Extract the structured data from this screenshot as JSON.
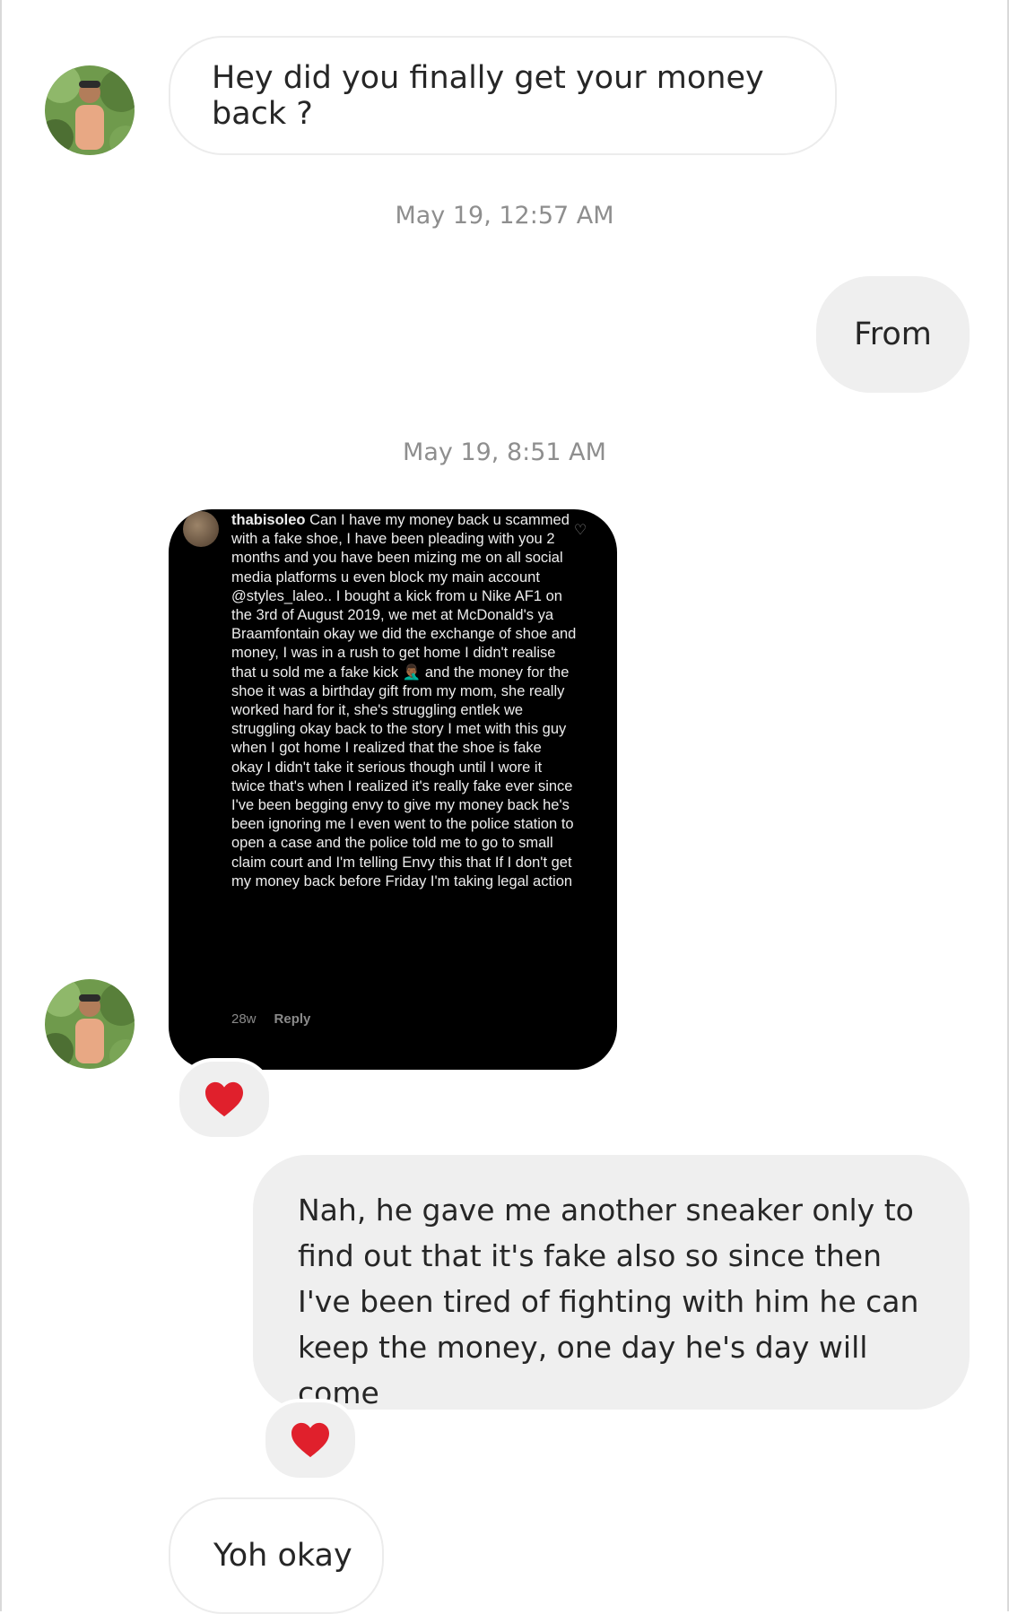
{
  "thread": {
    "msg1": {
      "text": "Hey did you finally get your money back ?"
    },
    "ts1": "May 19, 12:57 AM",
    "msg2": {
      "text": "From"
    },
    "ts2": "May 19, 8:51 AM",
    "shared_comment": {
      "username": "thabisoleo",
      "text": "Can I have my money back u scammed with a fake shoe, I have been pleading with you 2 months and you have been mizing me on all social media platforms u even block my main account @styles_laleo.. I bought a kick from u Nike AF1 on the 3rd of August 2019, we met at McDonald's ya Braamfontain okay we did the exchange of shoe and money, I was in a rush to get home I didn't realise that u sold me a fake kick 🤦🏾‍♂️ and the money for the shoe it was a birthday gift from my mom, she really worked hard for it, she's struggling entlek we struggling okay back to the story I met with this guy when I got home I realized that the shoe is fake okay I didn't take it serious though until I wore it twice that's when I realized it's really fake ever since I've been begging envy to give my money back he's been ignoring me I even went to the police station to open a case and the police told me to go to small claim court and I'm telling Envy this that If I don't get my money back before Friday I'm taking legal action",
      "age": "28w",
      "reply_label": "Reply"
    },
    "reaction1": "heart",
    "msg3": {
      "text": "Nah, he gave me another sneaker only to find out that it's fake also so since then I've been tired of fighting with him he can keep the money, one day he's day will come"
    },
    "reaction2": "heart",
    "msg4": {
      "text": "Yoh okay"
    }
  },
  "colors": {
    "outgoing_bubble": "#efefef",
    "incoming_border": "#ececec",
    "timestamp": "#8e8e8e",
    "heart": "#e0202c"
  }
}
